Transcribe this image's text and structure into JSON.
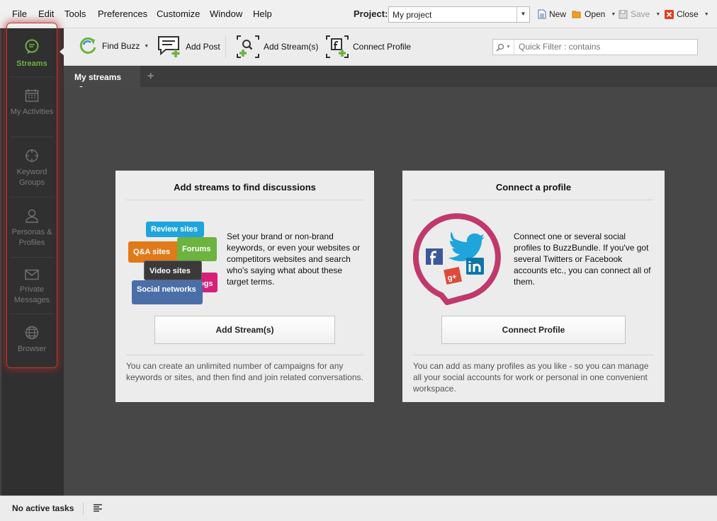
{
  "menu": {
    "file": "File",
    "edit": "Edit",
    "tools": "Tools",
    "preferences": "Preferences",
    "customize": "Customize",
    "window": "Window",
    "help": "Help"
  },
  "project": {
    "label": "Project:",
    "value": "My project"
  },
  "top_actions": {
    "new": "New",
    "open": "Open",
    "save": "Save",
    "close": "Close"
  },
  "sidebar": {
    "items": [
      {
        "label": "Streams",
        "icon": "chat-bubble-icon",
        "active": true
      },
      {
        "label": "My Activities",
        "icon": "calendar-icon",
        "active": false
      },
      {
        "label": "Keyword Groups",
        "icon": "crosshair-icon",
        "active": false
      },
      {
        "label": "Personas & Profiles",
        "icon": "person-icon",
        "active": false
      },
      {
        "label": "Private Messages",
        "icon": "envelope-icon",
        "active": false
      },
      {
        "label": "Browser",
        "icon": "globe-icon",
        "active": false
      }
    ]
  },
  "toolbar": {
    "find_buzz": "Find Buzz",
    "add_post": "Add Post",
    "add_streams": "Add Stream(s)",
    "connect_profile": "Connect Profile",
    "quick_filter_placeholder": "Quick Filter : contains"
  },
  "tabs": {
    "active": "My streams",
    "add": "+"
  },
  "card_streams": {
    "title": "Add streams to find discussions",
    "description": "Set your brand or non-brand keywords, or even your websites or competitors websites and search who's saying what about these target terms.",
    "button": "Add Stream(s)",
    "footer": "You can create an unlimited number of campaigns for any keywords or sites, and then find and join related conversations.",
    "bubbles": {
      "review": "Review sites",
      "qa": "Q&A sites",
      "forums": "Forums",
      "video": "Video sites",
      "blogs": "Blogs",
      "social": "Social networks"
    }
  },
  "card_profile": {
    "title": "Connect a profile",
    "description": "Connect one or several social profiles to BuzzBundle. If you've got several Twitters or Facebook accounts etc., you can connect all of them.",
    "button": "Connect Profile",
    "footer": "You can add as many profiles as you like - so you can manage all your social accounts for work or personal in one convenient workspace."
  },
  "status": {
    "text": "No active tasks"
  },
  "colors": {
    "accent_green": "#6cb33f",
    "sidebar_bg": "#303030",
    "content_bg": "#474747",
    "profile_ring": "#c0396b"
  }
}
